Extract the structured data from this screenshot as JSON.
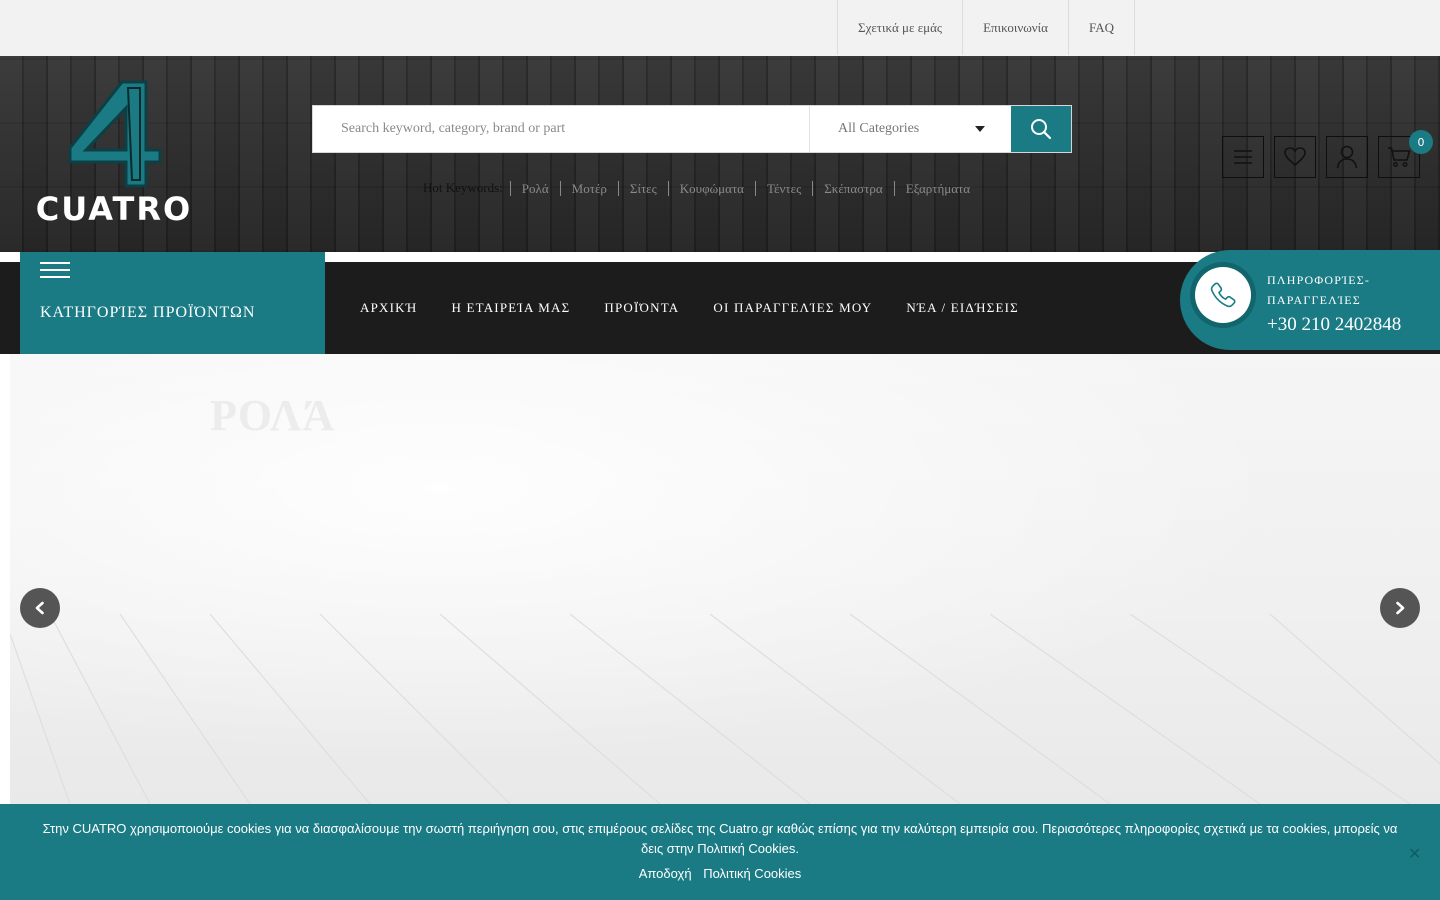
{
  "topbar": {
    "links": [
      "Σχετικά με εμάς",
      "Επικοινωνία",
      "FAQ"
    ]
  },
  "header": {
    "logo_text": "CUATRO",
    "colors": {
      "accent": "#1a7b85",
      "dark": "#1c1c1c"
    },
    "search": {
      "placeholder": "Search keyword, category, brand or part",
      "category_selected": "All Categories",
      "button_icon": "search-icon"
    },
    "hot_keywords": {
      "label": "Hot Keywords:",
      "items": [
        "Ρολά",
        "Μοτέρ",
        "Σίτες",
        "Κουφώματα",
        "Τέντες",
        "Σκέπαστρα",
        "Εξαρτήματα"
      ]
    },
    "icons": [
      "menu-icon",
      "heart-icon",
      "user-icon",
      "cart-icon"
    ],
    "cart_count": "0"
  },
  "nav": {
    "categories_title": "ΚΑΤΗΓΟΡΊΕΣ ΠΡΟΪΌΝΤΩΝ",
    "items": [
      "ΑΡΧΙΚΉ",
      "Η ΕΤΑΙΡΕΊΑ ΜΑΣ",
      "ΠΡΟΪΌΝΤΑ",
      "ΟΙ ΠΑΡΑΓΓΕΛΊΕΣ ΜΟΥ",
      "ΝΈΑ / ΕΙΔΉΣΕΙΣ"
    ],
    "phone": {
      "label": "ΠΛΗΡΟΦΟΡΊΕΣ-ΠΑΡΑΓΓΕΛΊΕΣ",
      "number": "+30 210 2402848"
    }
  },
  "hero": {
    "slide_title": "ΡΟΛΆ"
  },
  "cookie": {
    "message": "Στην CUATRO χρησιμοποιούμε cookies για να διασφαλίσουμε την σωστή περιήγηση σου, στις επιμέρους σελίδες της Cuatro.gr καθώς επίσης για την καλύτερη εμπειρία σου. Περισσότερες πληροφορίες σχετικά με τα cookies, μπορείς να δεις στην Πολιτική Cookies.",
    "accept_label": "Αποδοχή",
    "policy_label": "Πολιτική Cookies"
  }
}
